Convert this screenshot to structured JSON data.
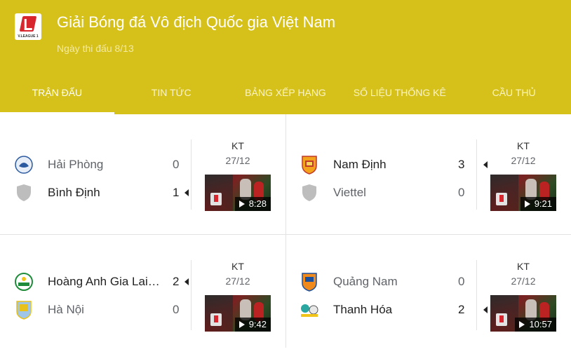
{
  "header": {
    "title": "Giải Bóng đá Vô địch Quốc gia Việt Nam",
    "subtitle": "Ngày thi đấu 8/13",
    "logo_text": "V.LEAGUE 1"
  },
  "tabs": [
    {
      "label": "TRẬN ĐẤU"
    },
    {
      "label": "TIN TỨC"
    },
    {
      "label": "BẢNG XẾP HẠNG"
    },
    {
      "label": "SỐ LIỆU THỐNG KÊ"
    },
    {
      "label": "CẦU THỦ"
    }
  ],
  "matches": [
    {
      "home": {
        "name": "Hải Phòng",
        "score": "0"
      },
      "away": {
        "name": "Bình Định",
        "score": "1"
      },
      "status": "KT",
      "date": "27/12",
      "duration": "8:28"
    },
    {
      "home": {
        "name": "Nam Định",
        "score": "3"
      },
      "away": {
        "name": "Viettel",
        "score": "0"
      },
      "status": "KT",
      "date": "27/12",
      "duration": "9:21"
    },
    {
      "home": {
        "name": "Hoàng Anh Gia Lai…",
        "score": "2"
      },
      "away": {
        "name": "Hà Nội",
        "score": "0"
      },
      "status": "KT",
      "date": "27/12",
      "duration": "9:42"
    },
    {
      "home": {
        "name": "Quảng Nam",
        "score": "0"
      },
      "away": {
        "name": "Thanh Hóa",
        "score": "2"
      },
      "status": "KT",
      "date": "27/12",
      "duration": "10:57"
    }
  ],
  "colors": {
    "header_bg": "#d6c01a",
    "accent": "#d8262f"
  }
}
